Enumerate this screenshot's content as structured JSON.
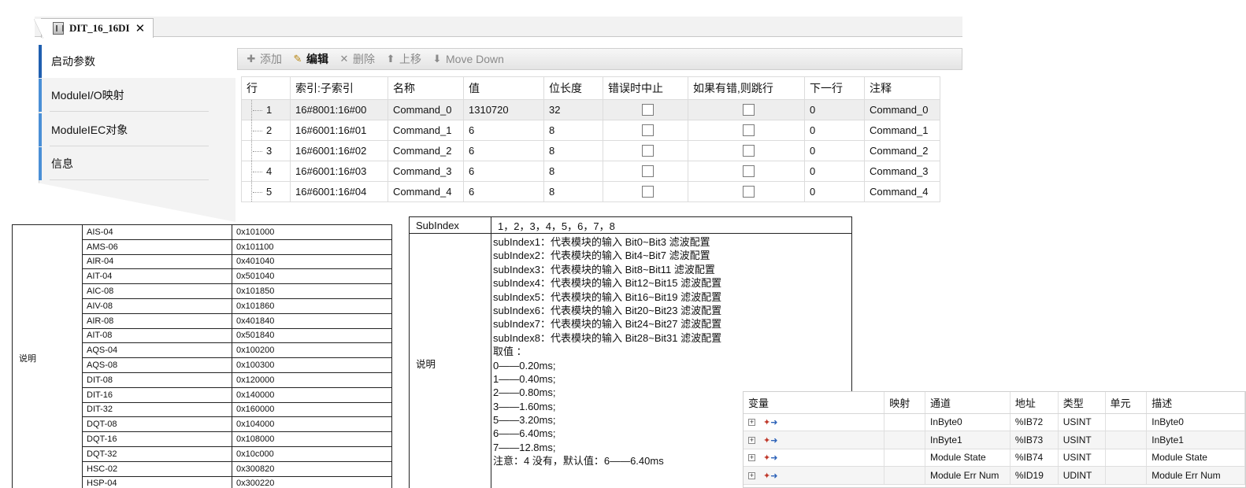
{
  "editor_tab": {
    "title": "DIT_16_16DI",
    "close_glyph": "✕"
  },
  "sidenav": {
    "items": [
      {
        "label": "启动参数"
      },
      {
        "label": "ModuleI/O映射"
      },
      {
        "label": "ModuleIEC对象"
      },
      {
        "label": "信息"
      }
    ]
  },
  "toolbar": {
    "add": "添加",
    "edit": "编辑",
    "delete": "删除",
    "move_up": "上移",
    "move_down": "Move Down"
  },
  "param_grid": {
    "headers": [
      "行",
      "索引:子索引",
      "名称",
      "值",
      "位长度",
      "错误时中止",
      "如果有错,则跳行",
      "下一行",
      "注释"
    ],
    "rows": [
      {
        "row": "1",
        "index": "16#8001:16#00",
        "name": "Command_0",
        "value": "1310720",
        "bitlen": "32",
        "abort": false,
        "jump": false,
        "next": "0",
        "comment": "Command_0"
      },
      {
        "row": "2",
        "index": "16#6001:16#01",
        "name": "Command_1",
        "value": "6",
        "bitlen": "8",
        "abort": false,
        "jump": false,
        "next": "0",
        "comment": "Command_1"
      },
      {
        "row": "3",
        "index": "16#6001:16#02",
        "name": "Command_2",
        "value": "6",
        "bitlen": "8",
        "abort": false,
        "jump": false,
        "next": "0",
        "comment": "Command_2"
      },
      {
        "row": "4",
        "index": "16#6001:16#03",
        "name": "Command_3",
        "value": "6",
        "bitlen": "8",
        "abort": false,
        "jump": false,
        "next": "0",
        "comment": "Command_3"
      },
      {
        "row": "5",
        "index": "16#6001:16#04",
        "name": "Command_4",
        "value": "6",
        "bitlen": "8",
        "abort": false,
        "jump": false,
        "next": "0",
        "comment": "Command_4"
      }
    ]
  },
  "module_table": {
    "label": "说明",
    "rows": [
      [
        "AIS-04",
        "0x101000"
      ],
      [
        "AMS-06",
        "0x101100"
      ],
      [
        "AIR-04",
        "0x401040"
      ],
      [
        "AIT-04",
        "0x501040"
      ],
      [
        "AIC-08",
        "0x101850"
      ],
      [
        "AIV-08",
        "0x101860"
      ],
      [
        "AIR-08",
        "0x401840"
      ],
      [
        "AIT-08",
        "0x501840"
      ],
      [
        "AQS-04",
        "0x100200"
      ],
      [
        "AQS-08",
        "0x100300"
      ],
      [
        "DIT-08",
        "0x120000"
      ],
      [
        "DIT-16",
        "0x140000"
      ],
      [
        "DIT-32",
        "0x160000"
      ],
      [
        "DQT-08",
        "0x104000"
      ],
      [
        "DQT-16",
        "0x108000"
      ],
      [
        "DQT-32",
        "0x10c000"
      ],
      [
        "HSC-02",
        "0x300820"
      ],
      [
        "HSP-04",
        "0x300220"
      ]
    ]
  },
  "subindex_table": {
    "head_label": "SubIndex",
    "head_value": "1，2，3，4，5，6，7，8",
    "desc_label": "说明",
    "lines": [
      "subIndex1：代表模块的输入 Bit0~Bit3 滤波配置",
      "subIndex2：代表模块的输入 Bit4~Bit7 滤波配置",
      "subIndex3：代表模块的输入 Bit8~Bit11 滤波配置",
      "subIndex4：代表模块的输入 Bit12~Bit15 滤波配置",
      "subIndex5：代表模块的输入 Bit16~Bit19 滤波配置",
      "subIndex6：代表模块的输入 Bit20~Bit23 滤波配置",
      "subIndex7：代表模块的输入 Bit24~Bit27 滤波配置",
      "subIndex8：代表模块的输入 Bit28~Bit31 滤波配置",
      "取值 ：",
      "0——0.20ms;",
      "1——0.40ms;",
      "2——0.80ms;",
      "3——1.60ms;",
      "5——3.20ms;",
      "6——6.40ms;",
      "7——12.8ms;",
      "注意：4 没有，默认值：6——6.40ms"
    ]
  },
  "io_mapping": {
    "headers": [
      "变量",
      "映射",
      "通道",
      "地址",
      "类型",
      "单元",
      "描述"
    ],
    "rows": [
      {
        "channel": "InByte0",
        "address": "%IB72",
        "type": "USINT",
        "unit": "",
        "desc": "InByte0"
      },
      {
        "channel": "InByte1",
        "address": "%IB73",
        "type": "USINT",
        "unit": "",
        "desc": "InByte1"
      },
      {
        "channel": "Module State",
        "address": "%IB74",
        "type": "USINT",
        "unit": "",
        "desc": "Module State"
      },
      {
        "channel": "Module Err Num",
        "address": "%ID19",
        "type": "UDINT",
        "unit": "",
        "desc": "Module Err Num"
      }
    ]
  }
}
